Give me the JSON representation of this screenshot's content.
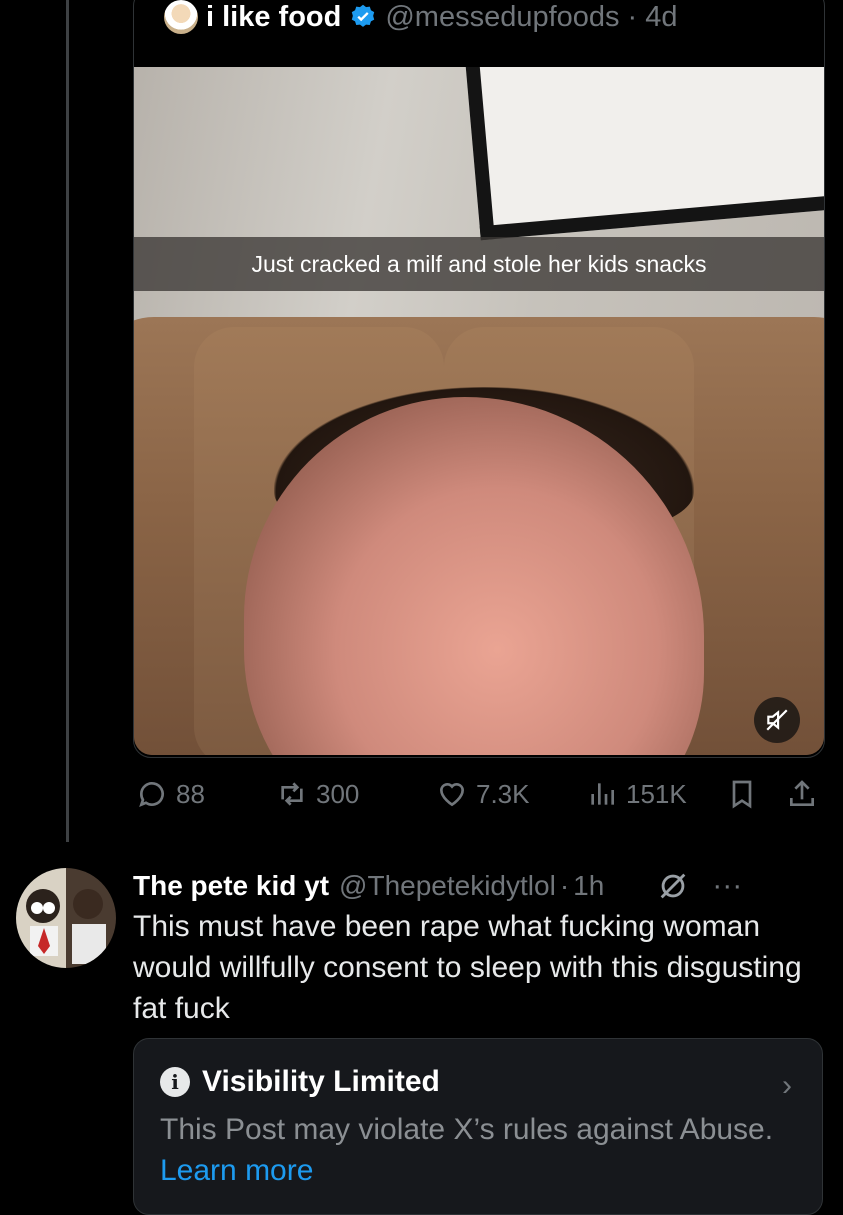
{
  "quoted": {
    "name": "i like food",
    "handle": "@messedupfoods",
    "sep": "·",
    "time": "4d",
    "caption": "Just cracked a milf and stole her kids snacks",
    "stats": {
      "replies": "88",
      "reposts": "300",
      "likes": "7.3K",
      "views": "151K"
    }
  },
  "reply": {
    "name": "The pete kid yt",
    "handle": "@Thepetekidytlol",
    "sep": "·",
    "time": "1h",
    "text": "This must have been rape what fucking woman would willfully consent to sleep with this disgusting fat fuck",
    "more": "···"
  },
  "notice": {
    "title": "Visibility Limited",
    "body": "This Post may violate X’s rules against Abuse.",
    "link": "Learn more",
    "chevron": "›"
  },
  "colors": {
    "accent": "#1d9bf0",
    "muted": "#71767b",
    "background": "#000000"
  }
}
